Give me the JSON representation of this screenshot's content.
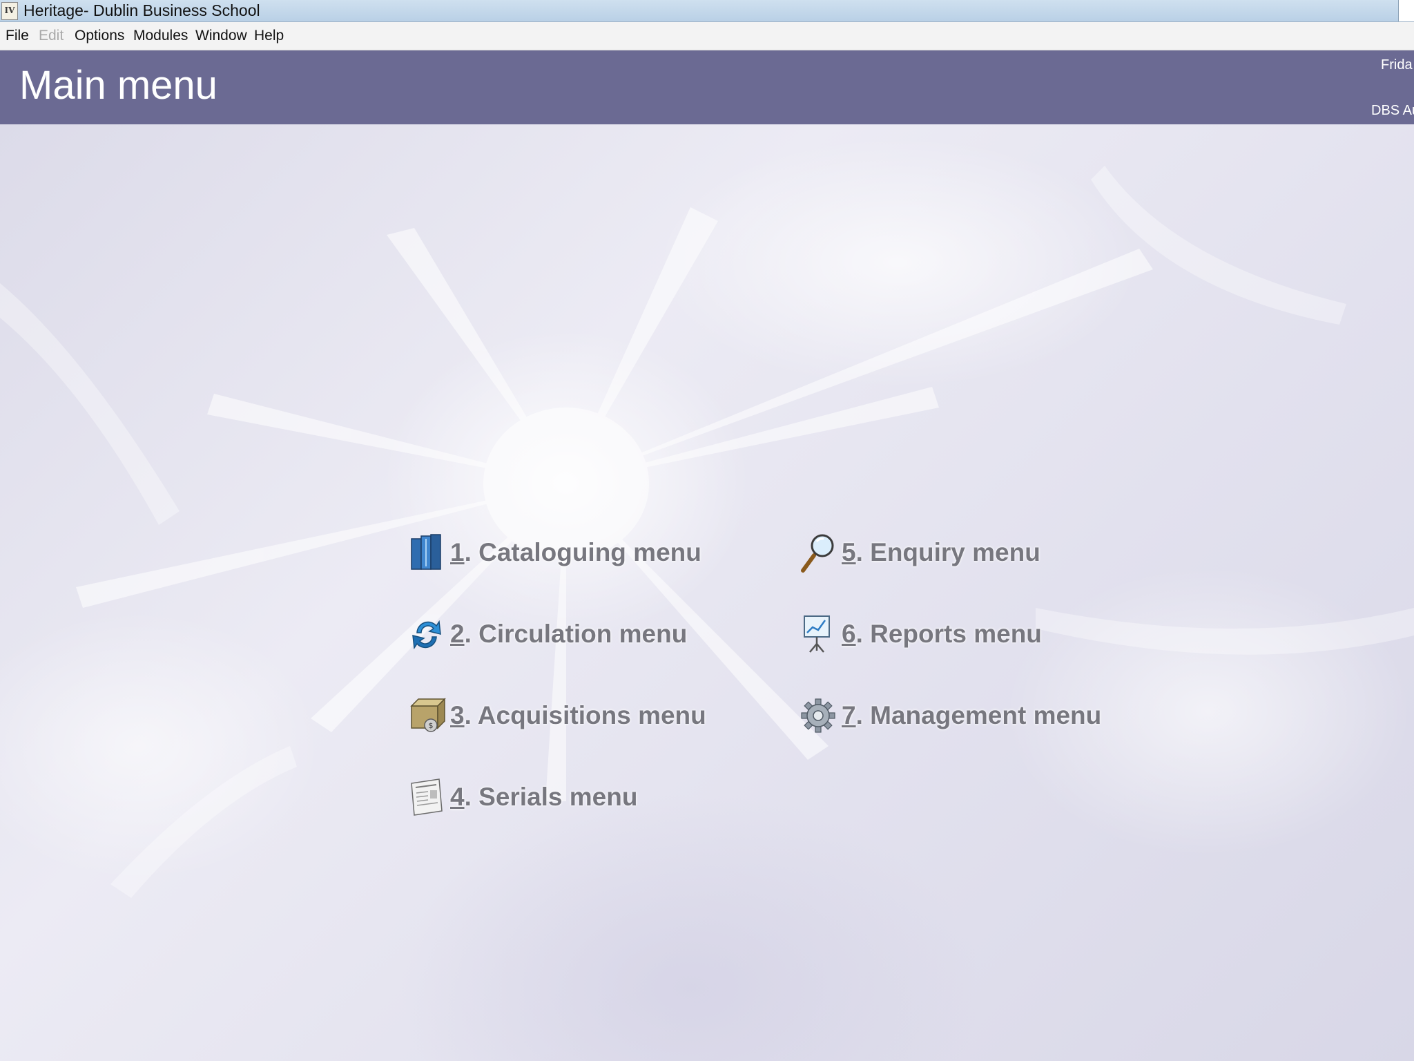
{
  "window": {
    "title": "Heritage- Dublin Business School",
    "app_icon_text": "IV"
  },
  "menubar": {
    "file": "File",
    "edit": "Edit",
    "options": "Options",
    "modules": "Modules",
    "window": "Window",
    "help": "Help"
  },
  "header": {
    "title": "Main menu",
    "info_line1": "Frida",
    "info_line2": "DBS Au"
  },
  "menu_items": [
    {
      "num": "1",
      "text": ". Cataloguing menu",
      "icon": "books-icon"
    },
    {
      "num": "2",
      "text": ". Circulation menu",
      "icon": "circulation-arrows-icon"
    },
    {
      "num": "3",
      "text": ". Acquisitions menu",
      "icon": "acquisitions-box-icon"
    },
    {
      "num": "4",
      "text": ". Serials menu",
      "icon": "newspaper-icon"
    },
    {
      "num": "5",
      "text": ". Enquiry menu",
      "icon": "magnifier-icon"
    },
    {
      "num": "6",
      "text": ". Reports menu",
      "icon": "chart-board-icon"
    },
    {
      "num": "7",
      "text": ". Management menu",
      "icon": "gear-icon"
    }
  ]
}
